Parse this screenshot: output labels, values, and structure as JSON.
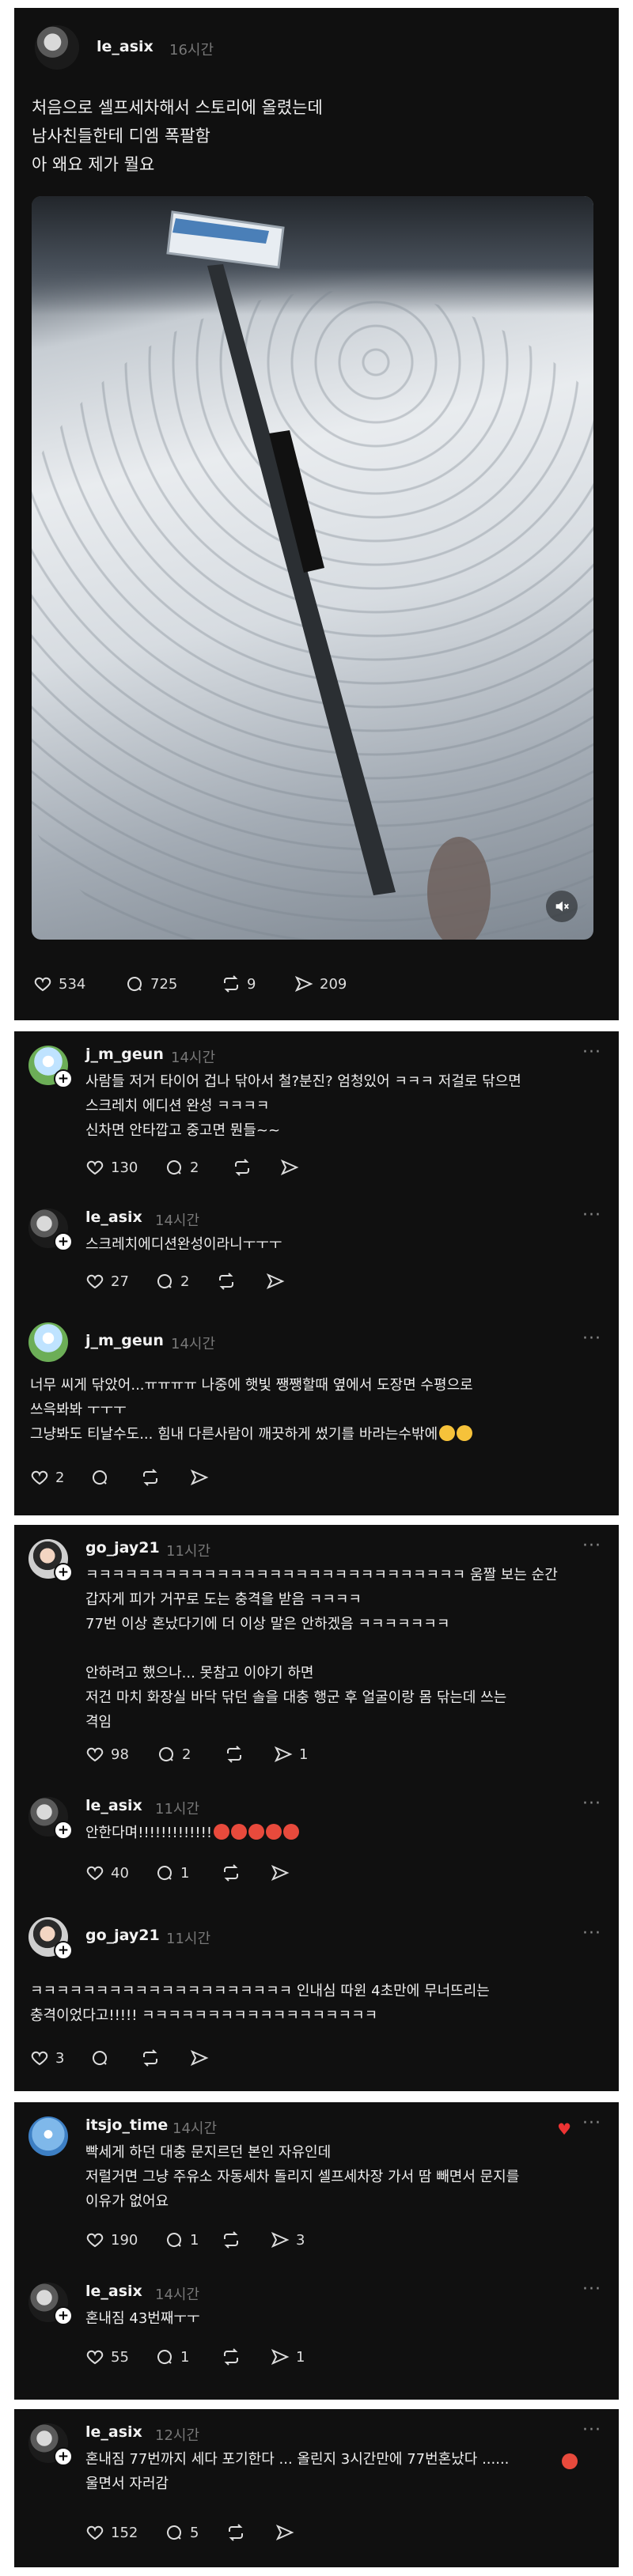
{
  "post": {
    "username": "le_asix",
    "time": "16시간",
    "text": "처음으로 셀프세차해서 스토리에 올렸는데\n남사친들한테 디엠 폭팔함\n아 왜요 제가 뭘요",
    "likes": "534",
    "comments": "725",
    "reposts": "9",
    "shares": "209"
  },
  "comments": [
    {
      "username": "j_m_geun",
      "time": "14시간",
      "text": "사람들 저거 타이어 겁나 닦아서 철?분진? 엄청있어 ㅋㅋㅋ 저걸로 닦으면\n스크레치 에디션 완성 ㅋㅋㅋㅋ\n신차면 안타깝고 중고면 뭔들~~",
      "likes": "130",
      "replies": "2"
    },
    {
      "username": "le_asix",
      "time": "14시간",
      "text": "스크레치에디션완성이라니ㅜㅜㅜ",
      "likes": "27",
      "replies": "2"
    },
    {
      "username": "j_m_geun",
      "time": "14시간",
      "text": "너무 씨게 닦았어...ㅠㅠㅠㅠ 나중에 햇빛 쨍쨍할때 옆에서 도장면 수평으로\n쓰윽봐봐 ㅜㅜㅜ\n그냥봐도 티날수도... 힘내 다른사람이 깨끗하게 썼기를 바라는수밖에",
      "likes": "2"
    },
    {
      "username": "go_jay21",
      "time": "11시간",
      "text": "ㅋㅋㅋㅋㅋㅋㅋㅋㅋㅋㅋㅋㅋㅋㅋㅋㅋㅋㅋㅋㅋㅋㅋㅋㅋㅋㅋㅋㅋ 움짤 보는 순간\n갑자게 피가 거꾸로 도는 충격을 받음 ㅋㅋㅋㅋ\n77번 이상 혼났다기에 더 이상 말은 안하겠음 ㅋㅋㅋㅋㅋㅋㅋ\n\n안하려고 했으나... 못참고 이야기 하면\n저건 마치 화장실 바닥 닦던 솔을 대충 행군 후 얼굴이랑 몸 닦는데 쓰는\n격임",
      "likes": "98",
      "replies": "2",
      "shares": "1"
    },
    {
      "username": "le_asix",
      "time": "11시간",
      "text": "안한다며!!!!!!!!!!!!!",
      "likes": "40",
      "replies": "1"
    },
    {
      "username": "go_jay21",
      "time": "11시간",
      "text": "ㅋㅋㅋㅋㅋㅋㅋㅋㅋㅋㅋㅋㅋㅋㅋㅋㅋㅋㅋㅋ 인내심 따윈 4초만에 무너뜨리는\n충격이었다고!!!!! ㅋㅋㅋㅋㅋㅋㅋㅋㅋㅋㅋㅋㅋㅋㅋㅋㅋㅋ",
      "likes": "3"
    },
    {
      "username": "itsjo_time",
      "time": "14시간",
      "text": "빡세게 하던 대충 문지르던 본인 자유인데\n저럴거면 그냥 주유소 자동세차 돌리지 셀프세차장 가서 땀 빼면서 문지를\n이유가 없어요",
      "likes": "190",
      "replies": "1",
      "shares": "3"
    },
    {
      "username": "le_asix",
      "time": "14시간",
      "text": "혼내짐 43번째ㅜㅜ",
      "likes": "55",
      "replies": "1",
      "shares": "1"
    },
    {
      "username": "le_asix",
      "time": "12시간",
      "text": "혼내짐 77번까지 세다 포기한다 ... 올린지 3시간만에 77번혼났다 ......\n울면서 자러감",
      "likes": "152",
      "replies": "5"
    }
  ],
  "icons": {
    "like": "heart-icon",
    "comment": "comment-icon",
    "repost": "repost-icon",
    "share": "share-icon",
    "more": "more-icon",
    "mute": "mute-icon"
  },
  "more_label": "···"
}
